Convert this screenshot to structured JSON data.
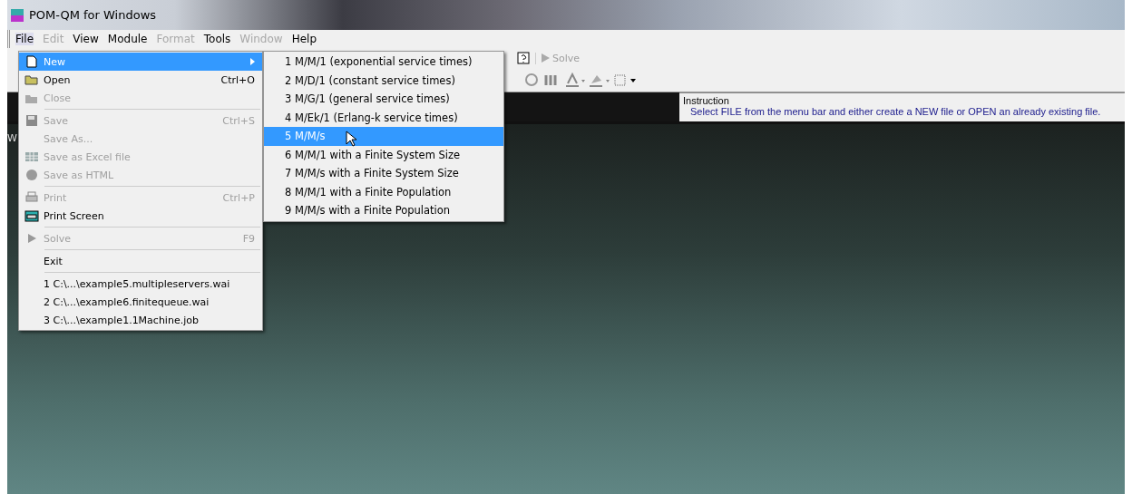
{
  "window": {
    "title": "POM-QM for Windows"
  },
  "menu_bar": [
    {
      "label": "File",
      "disabled": false,
      "selected": true
    },
    {
      "label": "Edit",
      "disabled": true,
      "selected": false
    },
    {
      "label": "View",
      "disabled": false,
      "selected": false
    },
    {
      "label": "Module",
      "disabled": false,
      "selected": false
    },
    {
      "label": "Format",
      "disabled": true,
      "selected": false
    },
    {
      "label": "Tools",
      "disabled": false,
      "selected": false
    },
    {
      "label": "Window",
      "disabled": true,
      "selected": false
    },
    {
      "label": "Help",
      "disabled": false,
      "selected": false
    }
  ],
  "toolbar": {
    "solve_button": {
      "label": "Solve",
      "disabled": true
    }
  },
  "instruction": {
    "title": "Instruction",
    "text": "Select FILE from the menu bar and either create a NEW file or OPEN an already existing file."
  },
  "workspace": {
    "cut_label": "W"
  },
  "file_menu": [
    {
      "kind": "item",
      "label": "New",
      "disabled": false,
      "selected": true,
      "submenu": true
    },
    {
      "kind": "item",
      "label": "Open",
      "shortcut": "Ctrl+O",
      "disabled": false,
      "selected": false,
      "submenu": false
    },
    {
      "kind": "item",
      "label": "Close",
      "disabled": true,
      "selected": false,
      "submenu": false
    },
    {
      "kind": "separator"
    },
    {
      "kind": "item",
      "label": "Save",
      "shortcut": "Ctrl+S",
      "disabled": true,
      "selected": false,
      "submenu": false
    },
    {
      "kind": "item",
      "label": "Save As...",
      "disabled": true,
      "selected": false,
      "submenu": false
    },
    {
      "kind": "item",
      "label": "Save as Excel file",
      "disabled": true,
      "selected": false,
      "submenu": false
    },
    {
      "kind": "item",
      "label": "Save as HTML",
      "disabled": true,
      "selected": false,
      "submenu": false
    },
    {
      "kind": "separator"
    },
    {
      "kind": "item",
      "label": "Print",
      "shortcut": "Ctrl+P",
      "disabled": true,
      "selected": false,
      "submenu": false
    },
    {
      "kind": "item",
      "label": "Print Screen",
      "disabled": false,
      "selected": false,
      "submenu": false
    },
    {
      "kind": "separator"
    },
    {
      "kind": "item",
      "label": "Solve",
      "shortcut": "F9",
      "disabled": true,
      "selected": false,
      "submenu": false
    },
    {
      "kind": "separator"
    },
    {
      "kind": "item",
      "label": "Exit",
      "disabled": false,
      "selected": false,
      "submenu": false
    },
    {
      "kind": "separator"
    },
    {
      "kind": "item",
      "label": "1 C:\\...\\example5.multipleservers.wai",
      "disabled": false,
      "selected": false,
      "submenu": false
    },
    {
      "kind": "item",
      "label": "2 C:\\...\\example6.finitequeue.wai",
      "disabled": false,
      "selected": false,
      "submenu": false
    },
    {
      "kind": "item",
      "label": "3 C:\\...\\example1.1Machine.job",
      "disabled": false,
      "selected": false,
      "submenu": false
    }
  ],
  "new_submenu": [
    {
      "label": "1 M/M/1  (exponential service times)",
      "selected": false
    },
    {
      "label": "2 M/D/1  (constant service times)",
      "selected": false
    },
    {
      "label": "3 M/G/1  (general service times)",
      "selected": false
    },
    {
      "label": "4 M/Ek/1 (Erlang-k service times)",
      "selected": false
    },
    {
      "label": "5 M/M/s",
      "selected": true
    },
    {
      "label": "6 M/M/1 with a Finite System Size",
      "selected": false
    },
    {
      "label": "7 M/M/s with a Finite System Size",
      "selected": false
    },
    {
      "label": "8 M/M/1 with a Finite Population",
      "selected": false
    },
    {
      "label": "9 M/M/s with a Finite Population",
      "selected": false
    }
  ]
}
